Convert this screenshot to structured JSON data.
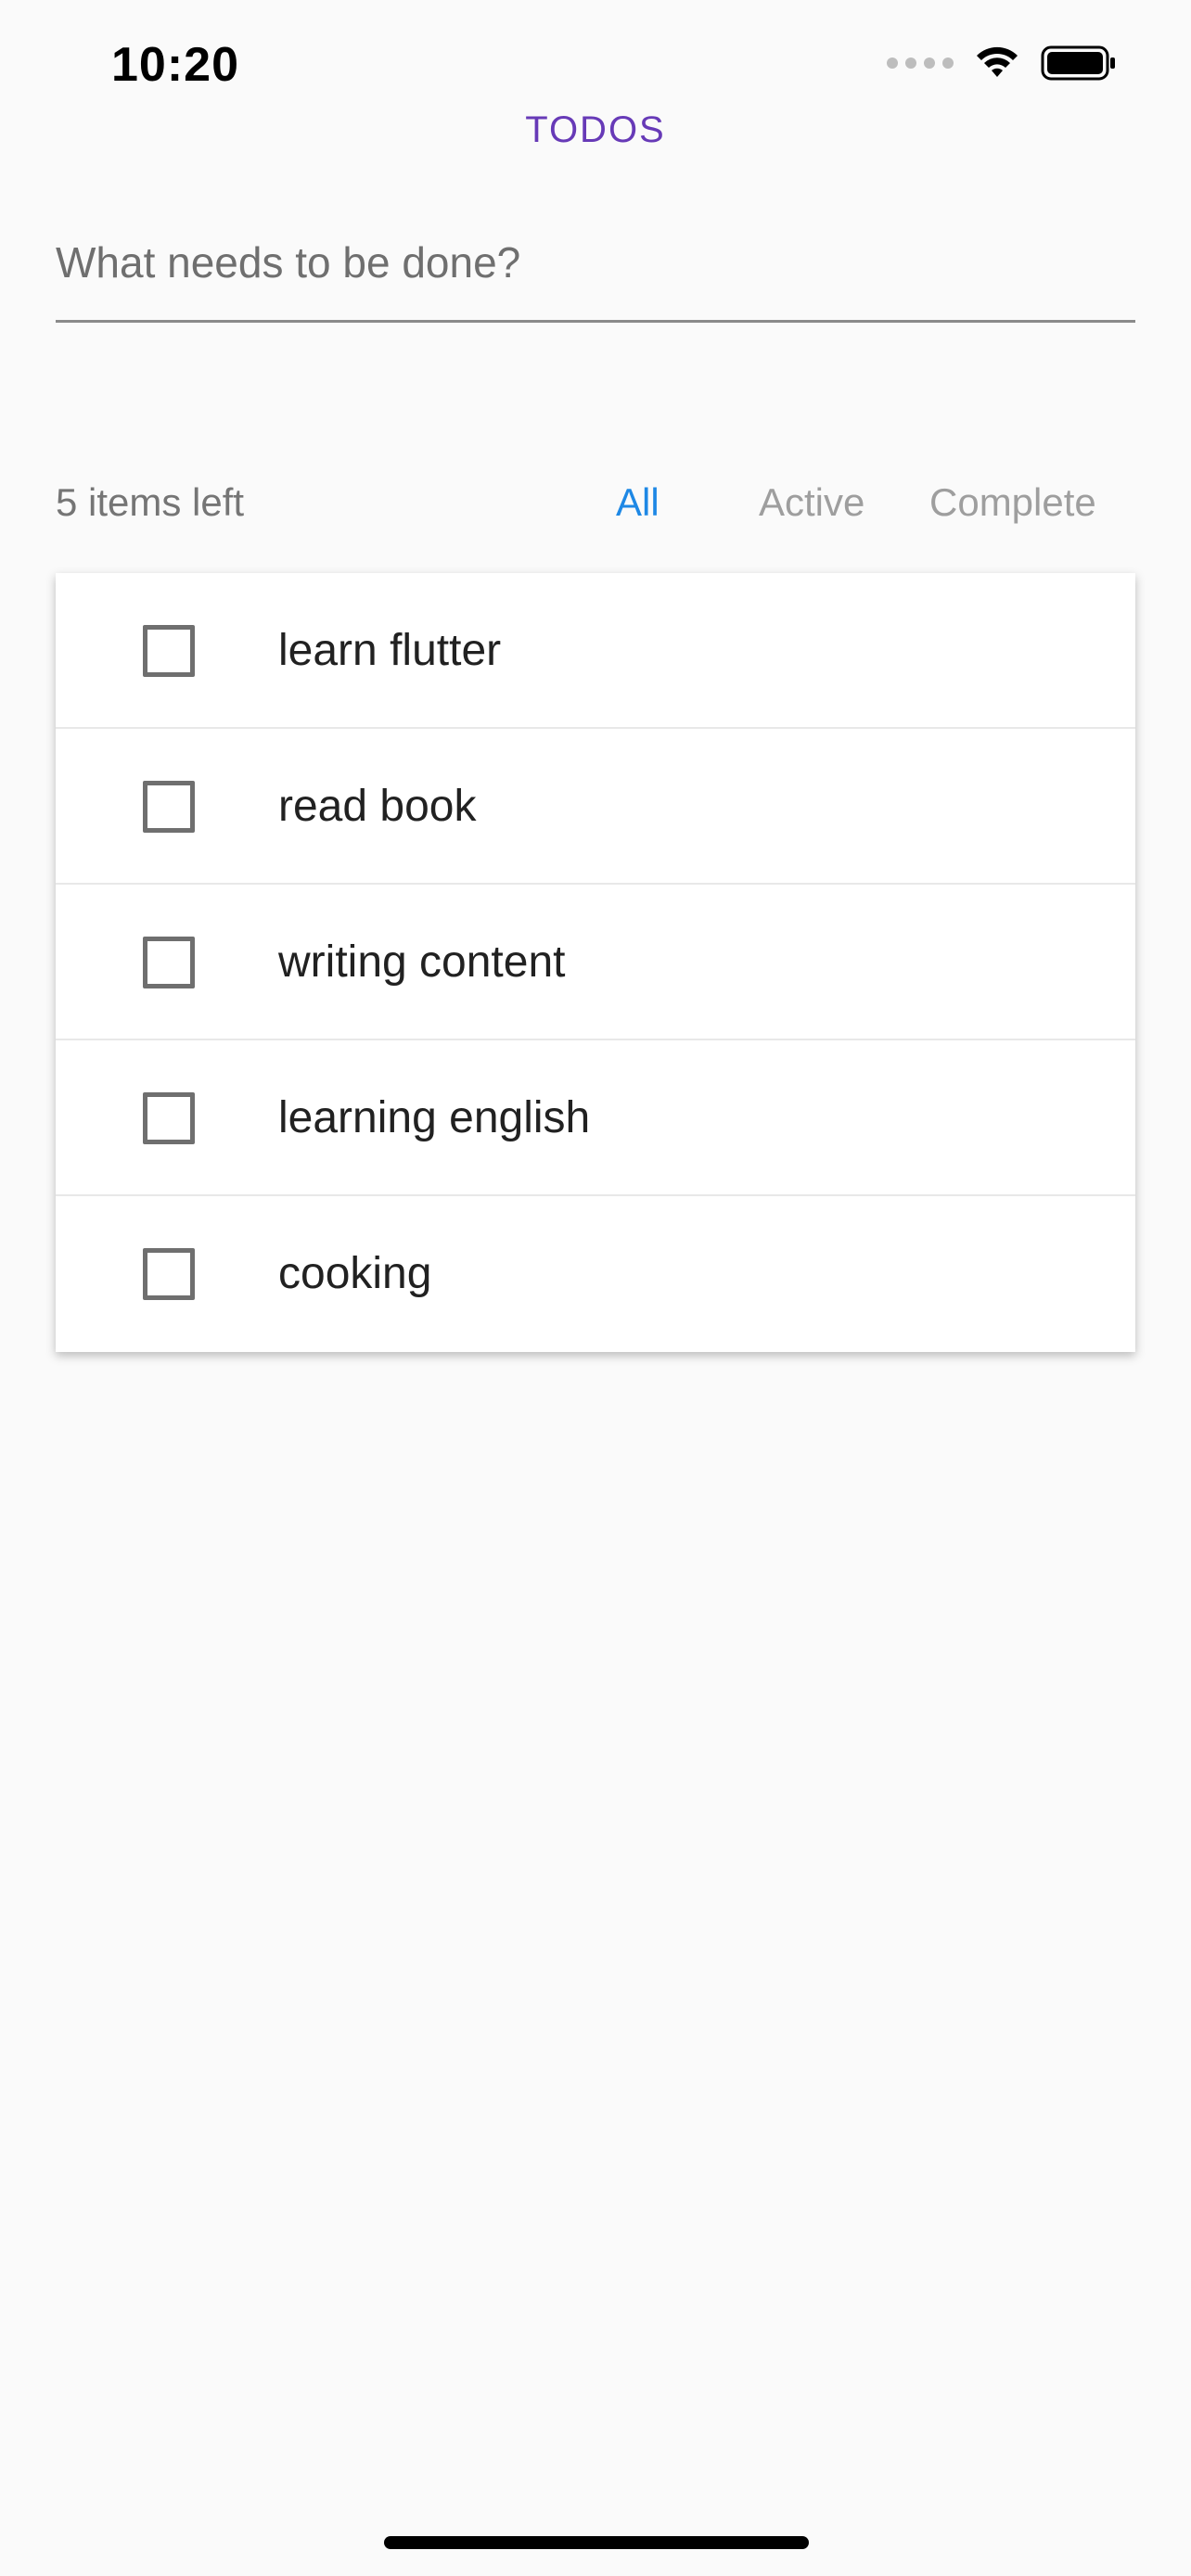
{
  "status_bar": {
    "time": "10:20",
    "icons": [
      "signal-dots-icon",
      "wifi-icon",
      "battery-icon"
    ]
  },
  "app": {
    "title": "TODOS",
    "title_color": "#673ab7"
  },
  "new_todo": {
    "placeholder": "What needs to be done?",
    "value": ""
  },
  "footer": {
    "items_left": "5 items left",
    "filters": [
      {
        "label": "All",
        "selected": true
      },
      {
        "label": "Active",
        "selected": false
      },
      {
        "label": "Complete",
        "selected": false
      }
    ],
    "selected_color": "#1e88e5"
  },
  "todos": [
    {
      "label": "learn flutter",
      "done": false
    },
    {
      "label": "read book",
      "done": false
    },
    {
      "label": "writing content",
      "done": false
    },
    {
      "label": "learning english",
      "done": false
    },
    {
      "label": "cooking",
      "done": false
    }
  ]
}
